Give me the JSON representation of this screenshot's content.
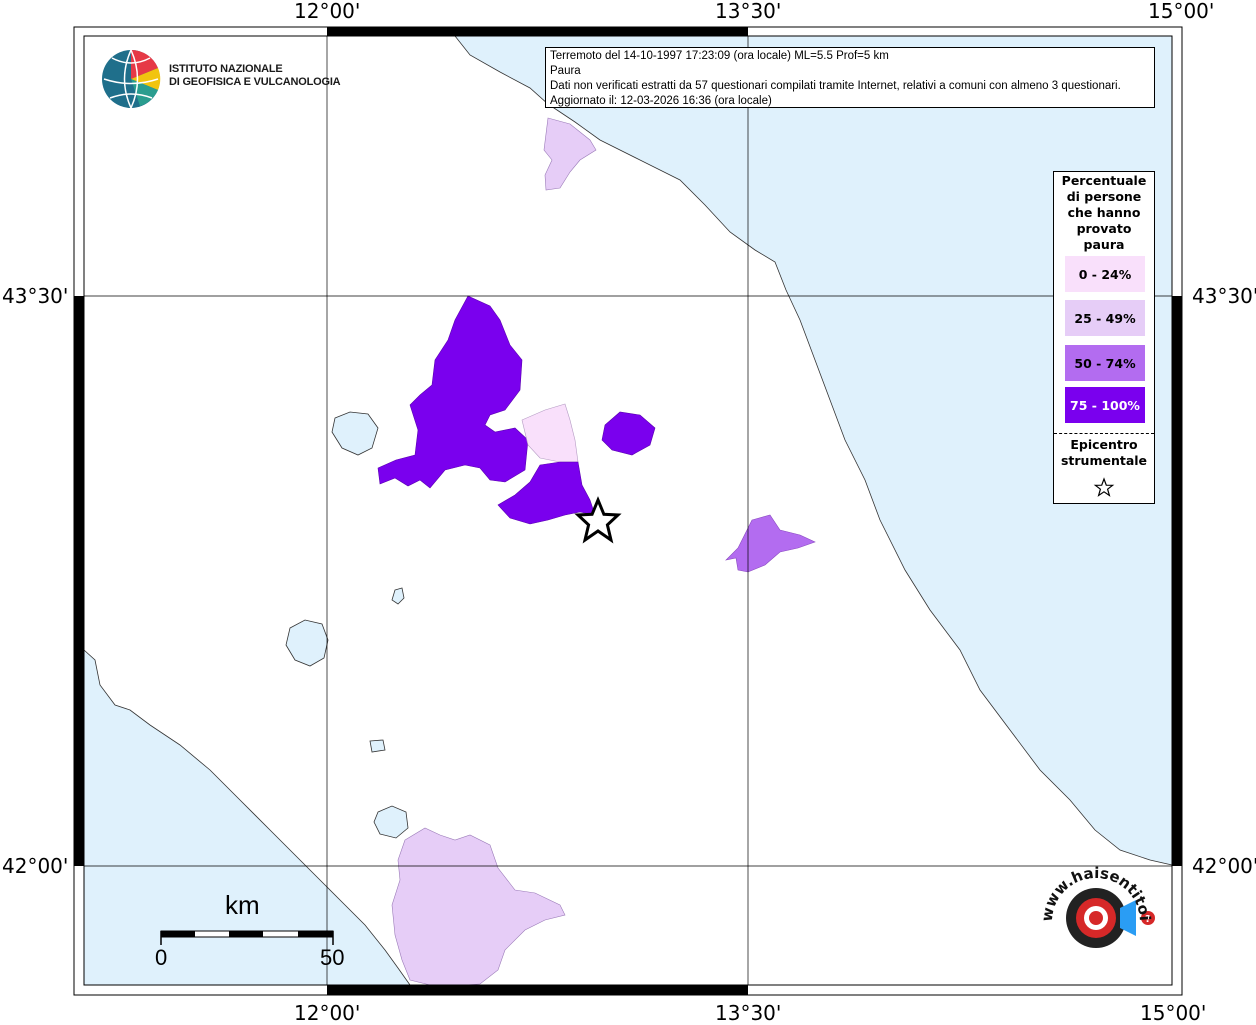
{
  "graticule": {
    "lon_labels": [
      "12°00'",
      "13°30'",
      "15°00'"
    ],
    "lat_labels": [
      "43°30'",
      "42°00'"
    ]
  },
  "info": {
    "line1": "Terremoto del 14-10-1997 17:23:09 (ora locale) ML=5.5 Prof=5 km",
    "line2": "Paura",
    "line3": "Dati non verificati estratti da 57 questionari compilati tramite Internet, relativi a comuni con almeno 3 questionari.",
    "line4": "Aggiornato il: 12-03-2026 16:36 (ora locale)"
  },
  "legend": {
    "title": [
      "Percentuale",
      "di persone",
      "che hanno",
      "provato",
      "paura"
    ],
    "items": [
      {
        "label": "0 - 24%",
        "color": "#f9e0fb"
      },
      {
        "label": "25 - 49%",
        "color": "#e6cdf7"
      },
      {
        "label": "50 - 74%",
        "color": "#b36cf0"
      },
      {
        "label": "75 - 100%",
        "color": "#7a00ee"
      }
    ],
    "epicenter_label": [
      "Epicentro",
      "strumentale"
    ]
  },
  "logos": {
    "ingv_line1": "ISTITUTO NAZIONALE",
    "ingv_line2": "DI GEOFISICA E VULCANOLOGIA",
    "hst_text": "www.haisentitoilterremoto.it"
  },
  "scale": {
    "unit": "km",
    "start": "0",
    "end": "50"
  },
  "colors": {
    "sea": "#dff1fc",
    "land": "#ffffff"
  }
}
